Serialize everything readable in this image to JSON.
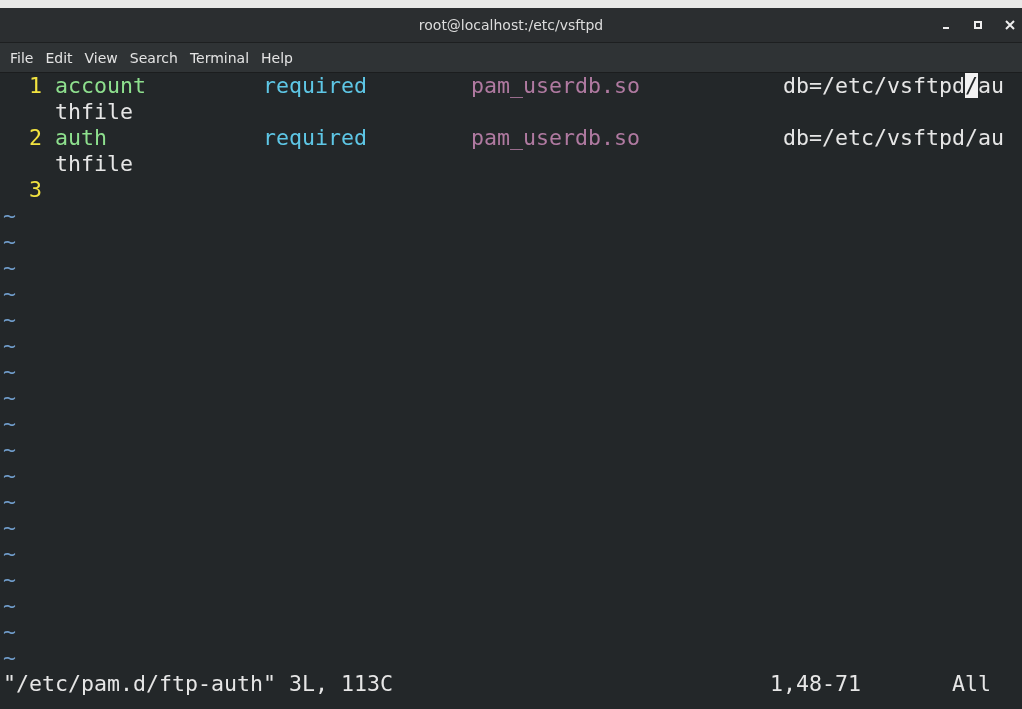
{
  "window": {
    "title": "root@localhost:/etc/vsftpd"
  },
  "menu": [
    "File",
    "Edit",
    "View",
    "Search",
    "Terminal",
    "Help"
  ],
  "editor": {
    "lines": [
      {
        "number": "1",
        "fields": [
          {
            "kind": "type",
            "text": "account"
          },
          {
            "kind": "control",
            "text": "required"
          },
          {
            "kind": "module",
            "text": "pam_userdb.so"
          },
          {
            "kind": "arg",
            "parts": [
              {
                "text": "db=/etc/vsftpd",
                "cursor": false
              },
              {
                "text": "/",
                "cursor": true
              },
              {
                "text": "au",
                "cursor": false
              }
            ]
          }
        ],
        "wrap": "thfile"
      },
      {
        "number": "2",
        "fields": [
          {
            "kind": "type",
            "text": "auth"
          },
          {
            "kind": "control",
            "text": "required"
          },
          {
            "kind": "module",
            "text": "pam_userdb.so"
          },
          {
            "kind": "arg",
            "parts": [
              {
                "text": "db=/etc/vsftpd/au",
                "cursor": false
              }
            ]
          }
        ],
        "wrap": "thfile"
      },
      {
        "number": "3"
      }
    ],
    "filler": [
      "~",
      "~",
      "~",
      "~",
      "~",
      "~",
      "~",
      "~",
      "~",
      "~",
      "~",
      "~",
      "~",
      "~",
      "~",
      "~",
      "~",
      "~"
    ]
  },
  "status_line": {
    "message": "\"/etc/pam.d/ftp-auth\" 3L, 113C",
    "position": "1,48-71",
    "scroll": "All"
  }
}
